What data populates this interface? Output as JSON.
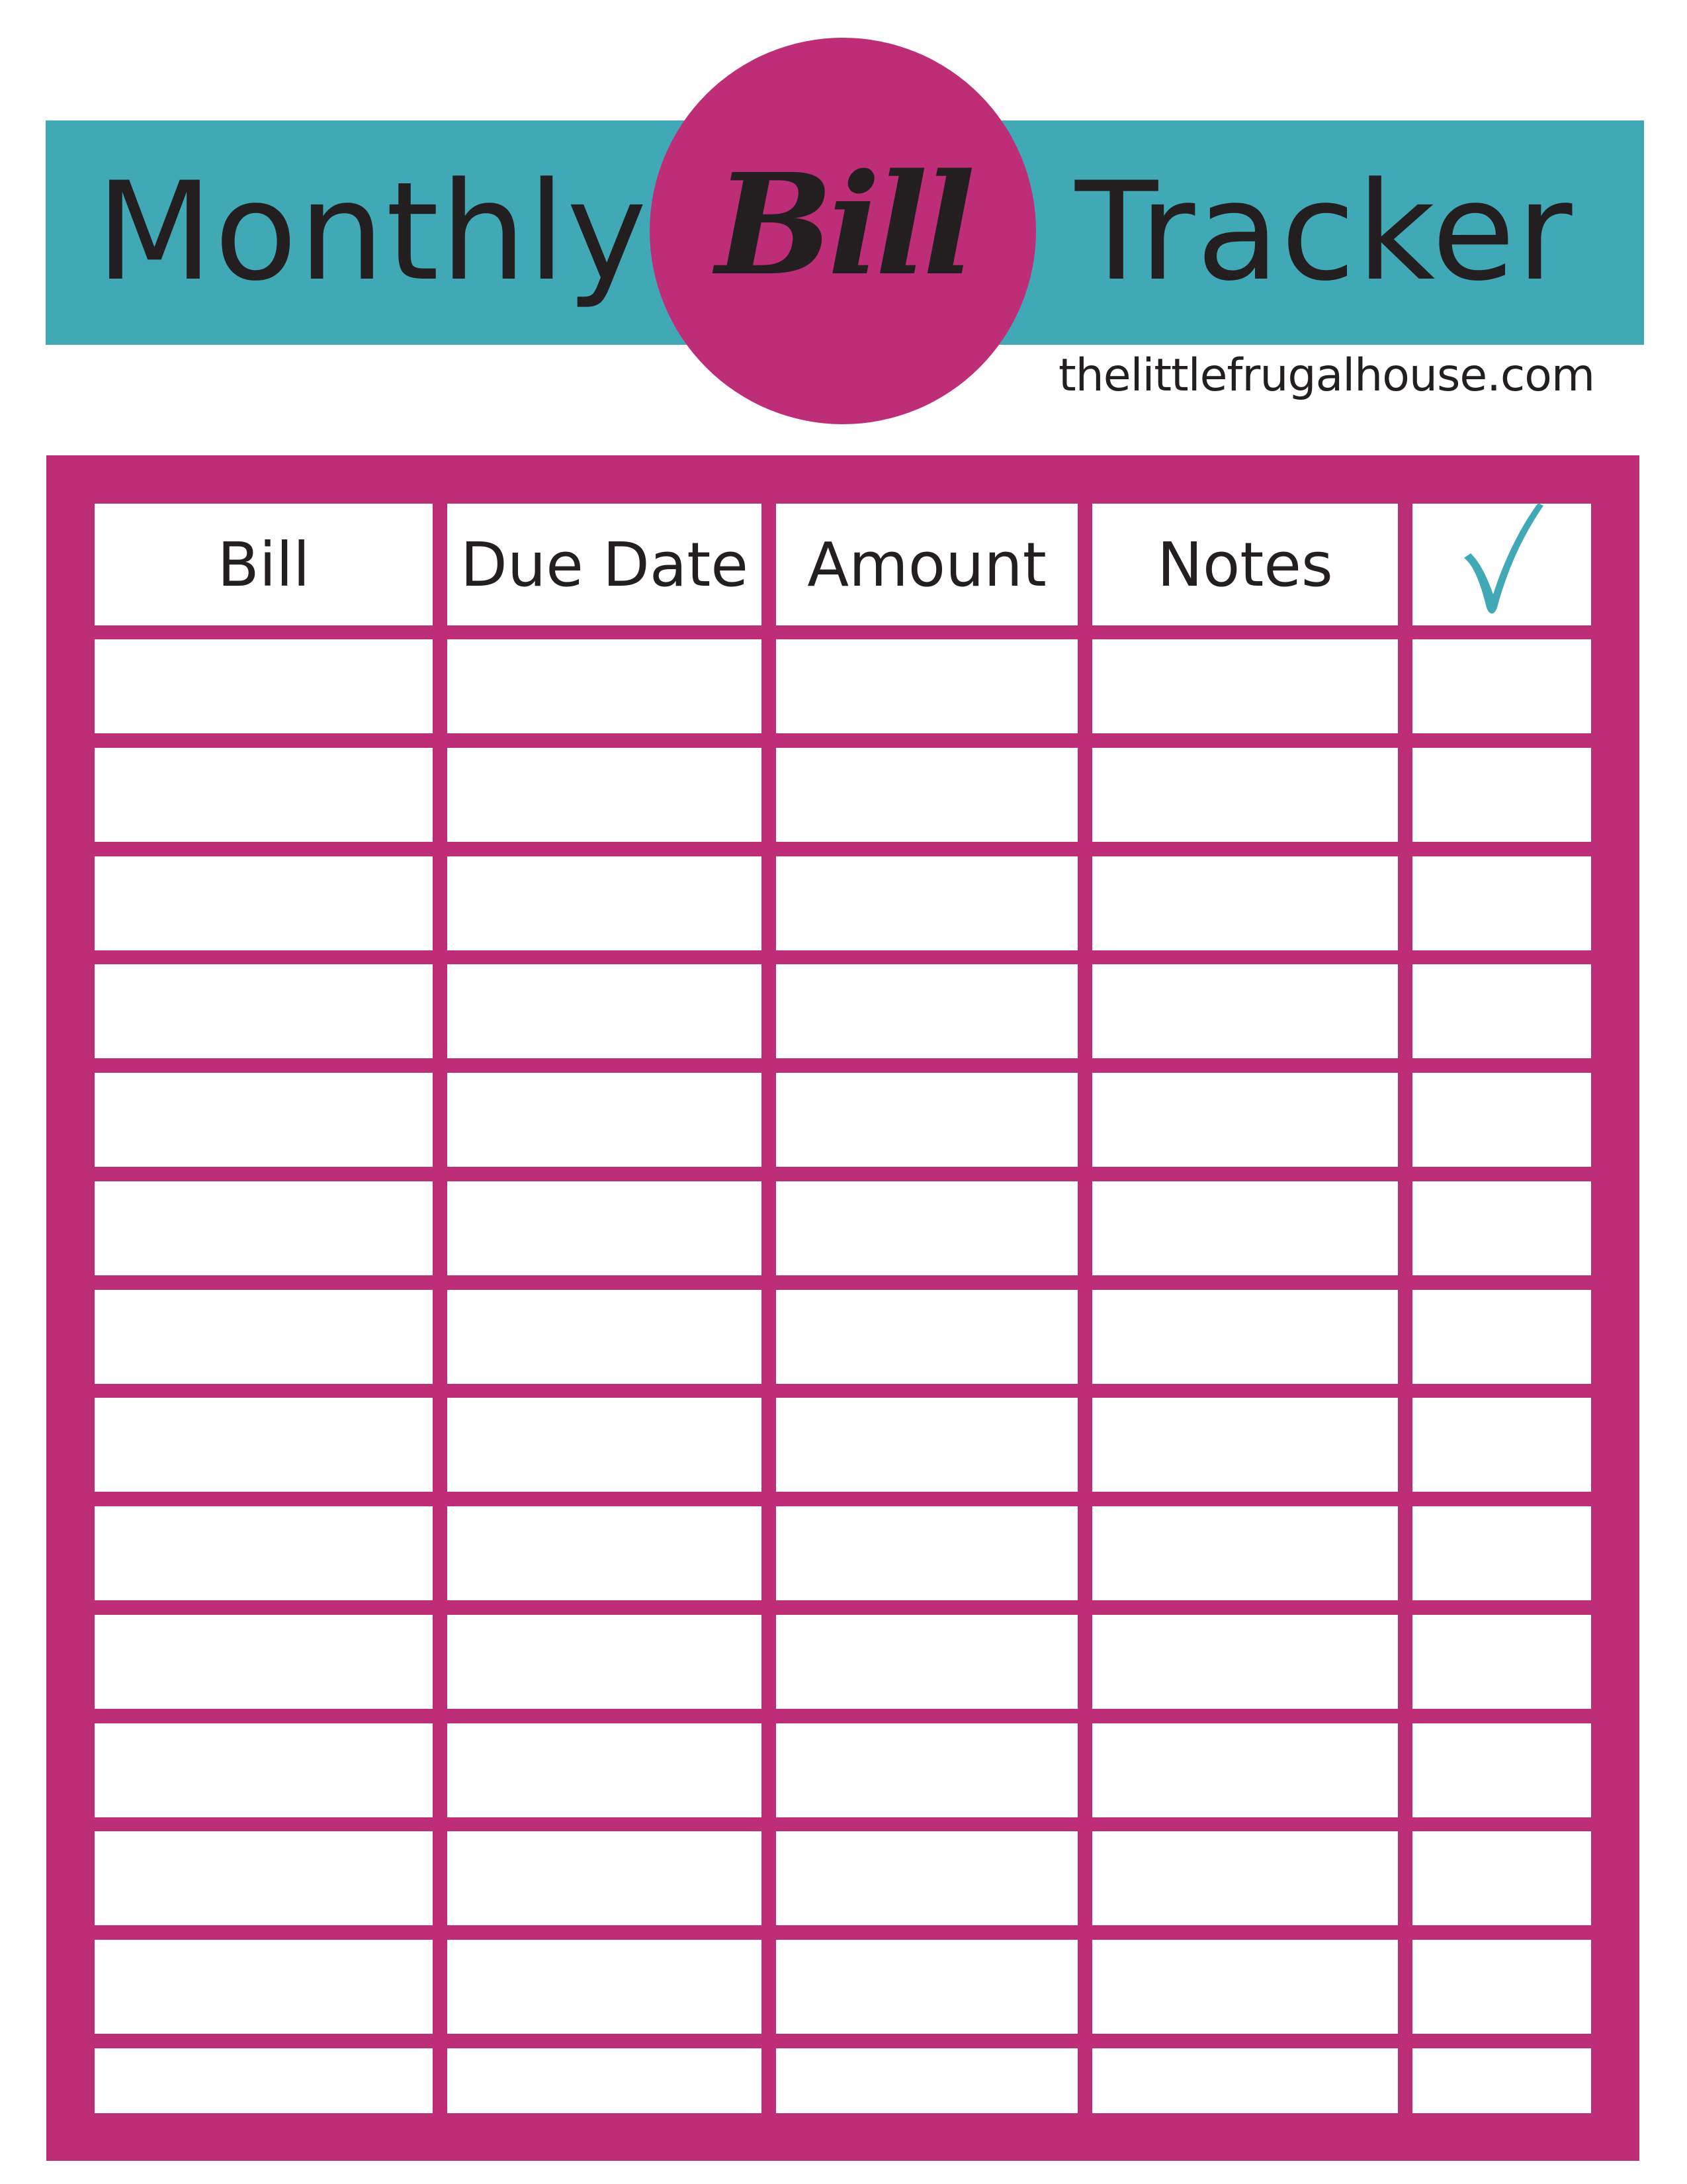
{
  "header": {
    "title_left": "Monthly",
    "title_center": "Bill",
    "title_right": "Tracker",
    "website": "thelittlefrugalhouse.com"
  },
  "colors": {
    "banner": "#41a9b6",
    "accent": "#be2e78",
    "text": "#231f20",
    "check": "#41a9b6"
  },
  "table": {
    "columns": [
      {
        "label": "Bill"
      },
      {
        "label": "Due Date"
      },
      {
        "label": "Amount"
      },
      {
        "label": "Notes"
      },
      {
        "label": "",
        "icon": "checkmark-icon"
      }
    ],
    "row_count": 14,
    "rows": [
      [
        "",
        "",
        "",
        "",
        ""
      ],
      [
        "",
        "",
        "",
        "",
        ""
      ],
      [
        "",
        "",
        "",
        "",
        ""
      ],
      [
        "",
        "",
        "",
        "",
        ""
      ],
      [
        "",
        "",
        "",
        "",
        ""
      ],
      [
        "",
        "",
        "",
        "",
        ""
      ],
      [
        "",
        "",
        "",
        "",
        ""
      ],
      [
        "",
        "",
        "",
        "",
        ""
      ],
      [
        "",
        "",
        "",
        "",
        ""
      ],
      [
        "",
        "",
        "",
        "",
        ""
      ],
      [
        "",
        "",
        "",
        "",
        ""
      ],
      [
        "",
        "",
        "",
        "",
        ""
      ],
      [
        "",
        "",
        "",
        "",
        ""
      ],
      [
        "",
        "",
        "",
        "",
        ""
      ]
    ]
  }
}
